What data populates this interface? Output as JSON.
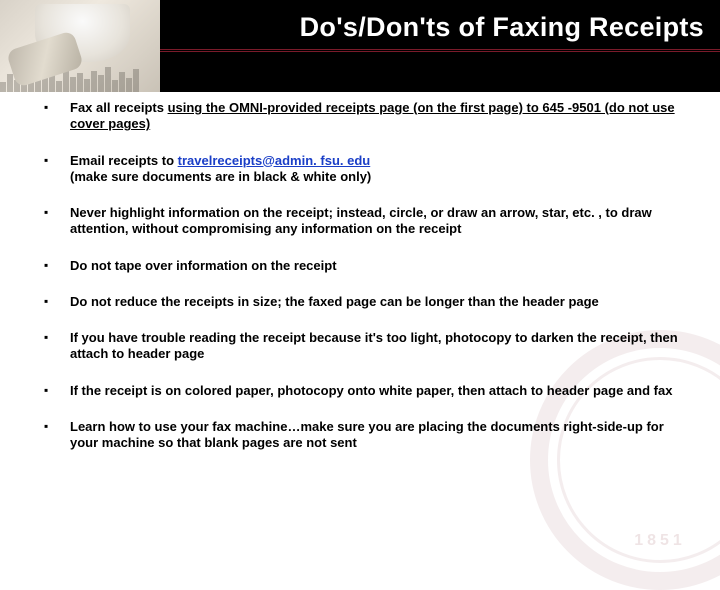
{
  "header": {
    "title": "Do's/Don'ts of Faxing Receipts"
  },
  "bullets": {
    "item0_pre": "Fax all receipts ",
    "item0_underline": "using the OMNI-provided receipts page (on the first page) to 645 -9501  (do not use cover pages)",
    "item1_pre": "Email receipts to ",
    "item1_link": "travelreceipts@admin. fsu. edu",
    "item1_post": "(make sure documents are in black & white only)",
    "item2": "Never highlight information on the receipt; instead, circle, or draw an arrow, star, etc. , to draw attention, without compromising any information on the receipt",
    "item3": "Do not tape over information on the receipt",
    "item4": "Do not reduce the receipts in size; the faxed page can be longer than the header page",
    "item5": "If you have trouble reading the receipt because it's too light, photocopy to darken the receipt, then attach to header page",
    "item6": "If the receipt is on colored paper, photocopy onto white paper, then attach to header page and fax",
    "item7": "Learn how to use your fax machine…make sure you are placing the documents right-side-up for your machine so that blank pages are not sent"
  },
  "seal": {
    "year": "1851"
  }
}
